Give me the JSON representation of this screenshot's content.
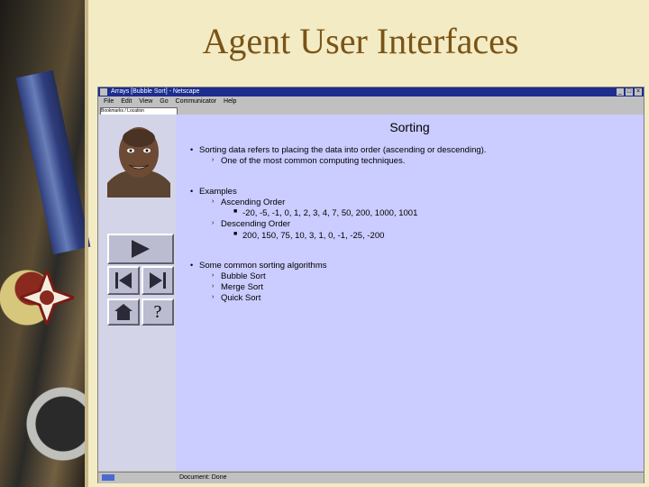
{
  "slide": {
    "title": "Agent User Interfaces"
  },
  "window": {
    "title": "Arrays [Bubble Sort] - Netscape",
    "menu": [
      "File",
      "Edit",
      "View",
      "Go",
      "Communicator",
      "Help"
    ],
    "location": "Bookmarks / Location",
    "status": "Document: Done"
  },
  "page": {
    "heading": "Sorting",
    "bullets": [
      {
        "text": "Sorting data refers to placing the data into order (ascending or descending).",
        "sub": [
          "One of the most common computing techniques."
        ]
      },
      {
        "text": "Examples",
        "sub": [
          "Ascending Order",
          "Descending Order"
        ],
        "subsub": [
          "-20, -5, -1, 0, 1, 2, 3, 4, 7, 50, 200, 1000, 1001",
          "200, 150, 75, 10, 3, 1, 0, -1, -25, -200"
        ]
      },
      {
        "text": "Some common sorting algorithms",
        "sub": [
          "Bubble Sort",
          "Merge Sort",
          "Quick Sort"
        ]
      }
    ]
  },
  "nav": {
    "help": "?"
  },
  "colors": {
    "content_bg": "#cbccff",
    "title_color": "#7a5416",
    "titlebar": "#1c2d8f"
  }
}
